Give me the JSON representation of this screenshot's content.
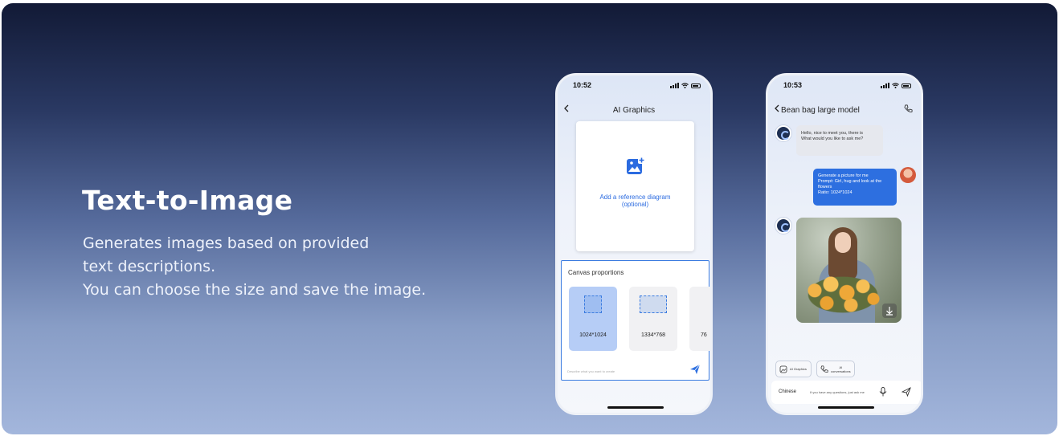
{
  "hero": {
    "title": "Text-to-Image",
    "description_lines": [
      "Generates images based on provided",
      "text descriptions.",
      "You can choose the size and save the image."
    ]
  },
  "phone1": {
    "time": "10:52",
    "title": "AI Graphics",
    "reference_label_line1": "Add a reference diagram",
    "reference_label_line2": "(optional)",
    "canvas_title": "Canvas proportions",
    "ratios": [
      "1024*1024",
      "1334*768",
      "76"
    ],
    "selected_ratio": "1024*1024",
    "input_placeholder": "Describe what you want to create"
  },
  "phone2": {
    "time": "10:53",
    "title": "Bean bag large model",
    "bot_message_line1": "Hello, nice to meet you, there is",
    "bot_message_line2": "What would you like to ask me?",
    "user_message_lines": [
      "Generate a picture for me",
      "Prompt: Girl, hug and look at the",
      "flowers",
      "Ratio: 1024*1024"
    ],
    "chip_ai_graphics": "AI Graphics",
    "chip_ai_conv_line1": "AI",
    "chip_ai_conv_line2": "conversations",
    "input_language": "Chinese",
    "input_placeholder": "If you have any questions, just ask me"
  },
  "colors": {
    "accent_blue": "#2d6fe0",
    "selected_ratio_bg": "#b6cdf6"
  }
}
